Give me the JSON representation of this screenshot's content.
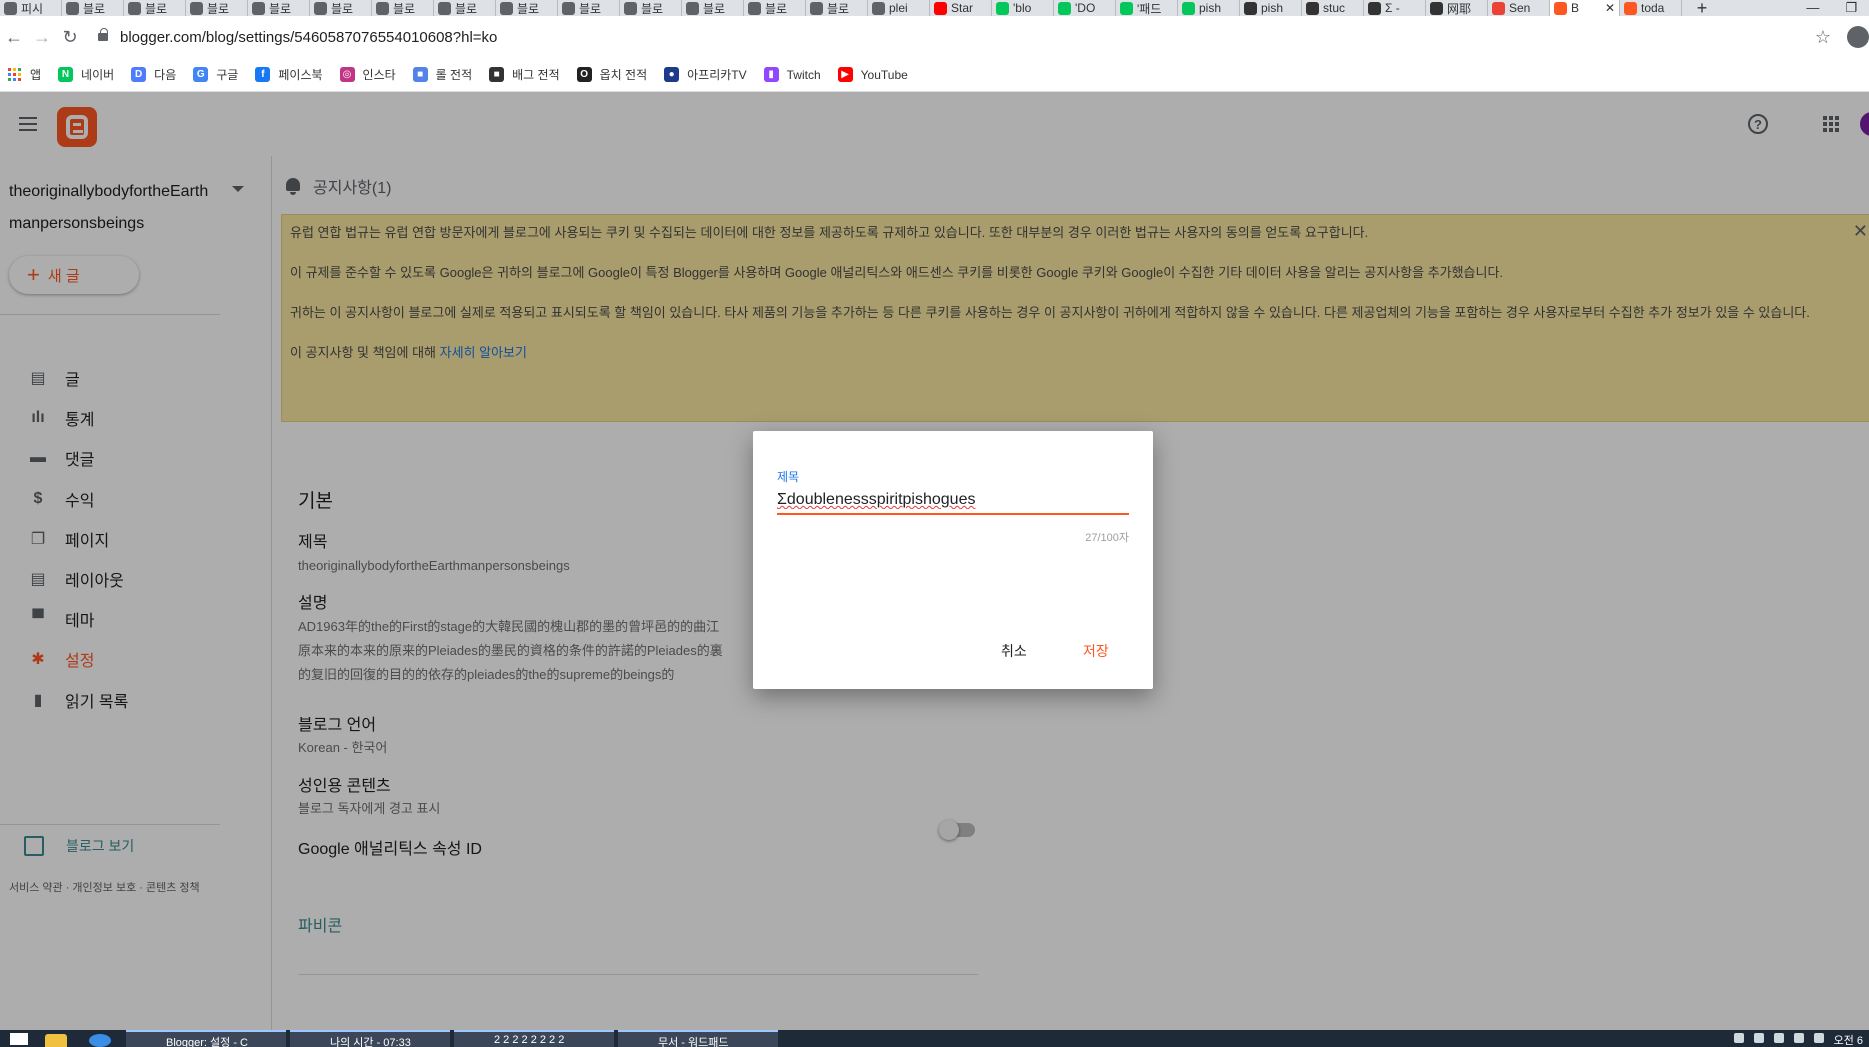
{
  "browser": {
    "tabs": [
      {
        "label": "피시",
        "icon_color": "#5f6368"
      },
      {
        "label": "블로",
        "icon_color": "#5f6368"
      },
      {
        "label": "블로",
        "icon_color": "#5f6368"
      },
      {
        "label": "블로",
        "icon_color": "#5f6368"
      },
      {
        "label": "블로",
        "icon_color": "#5f6368"
      },
      {
        "label": "블로",
        "icon_color": "#5f6368"
      },
      {
        "label": "블로",
        "icon_color": "#5f6368"
      },
      {
        "label": "블로",
        "icon_color": "#5f6368"
      },
      {
        "label": "블로",
        "icon_color": "#5f6368"
      },
      {
        "label": "블로",
        "icon_color": "#5f6368"
      },
      {
        "label": "블로",
        "icon_color": "#5f6368"
      },
      {
        "label": "블로",
        "icon_color": "#5f6368"
      },
      {
        "label": "블로",
        "icon_color": "#5f6368"
      },
      {
        "label": "블로",
        "icon_color": "#5f6368"
      },
      {
        "label": "plei",
        "icon_color": "#5f6368"
      },
      {
        "label": "Star",
        "icon_color": "#ff0000"
      },
      {
        "label": "'blo",
        "icon_color": "#03c75a"
      },
      {
        "label": "'DO",
        "icon_color": "#03c75a"
      },
      {
        "label": "'패드",
        "icon_color": "#03c75a"
      },
      {
        "label": "pish",
        "icon_color": "#03c75a"
      },
      {
        "label": "pish",
        "icon_color": "#333333"
      },
      {
        "label": "stuc",
        "icon_color": "#333333"
      },
      {
        "label": "Σ -",
        "icon_color": "#333333"
      },
      {
        "label": "网耶",
        "icon_color": "#333333"
      },
      {
        "label": "Sen",
        "icon_color": "#ea4335"
      }
    ],
    "active_tab": {
      "label": "B",
      "icon_color": "#ff5722"
    },
    "last_tab": {
      "label": "toda",
      "icon_color": "#ff5722"
    },
    "new_tab": "+",
    "window_controls": [
      "—",
      "❐"
    ],
    "url": "blogger.com/blog/settings/5460587076554010608?hl=ko",
    "bookmarks": [
      {
        "label": "앱",
        "icon": "apps-grid-icon"
      },
      {
        "label": "네이버",
        "icon": "naver-icon",
        "color": "#03c75a",
        "glyph": "N"
      },
      {
        "label": "다음",
        "icon": "daum-icon",
        "color": "#4d7cfe",
        "glyph": "D"
      },
      {
        "label": "구글",
        "icon": "google-icon",
        "color": "#4285f4",
        "glyph": "G"
      },
      {
        "label": "페이스북",
        "icon": "facebook-icon",
        "color": "#1877f2",
        "glyph": "f"
      },
      {
        "label": "인스타",
        "icon": "instagram-icon",
        "color": "#c13584",
        "glyph": "◎"
      },
      {
        "label": "롤 전적",
        "icon": "opgg-icon",
        "color": "#5383e8",
        "glyph": "■"
      },
      {
        "label": "배그 전적",
        "icon": "pubg-icon",
        "color": "#333333",
        "glyph": "■"
      },
      {
        "label": "옵치 전적",
        "icon": "overwatch-icon",
        "color": "#222222",
        "glyph": "O"
      },
      {
        "label": "아프리카TV",
        "icon": "afreecatv-icon",
        "color": "#1e3a8a",
        "glyph": "●"
      },
      {
        "label": "Twitch",
        "icon": "twitch-icon",
        "color": "#9146ff",
        "glyph": "▮"
      },
      {
        "label": "YouTube",
        "icon": "youtube-icon",
        "color": "#ff0000",
        "glyph": "▶"
      }
    ]
  },
  "blogger": {
    "blog_name": "theoriginallybodyfortheEarth manpersonsbeings",
    "new_post_label": "새 글",
    "nav": [
      {
        "label": "글",
        "icon": "posts-icon",
        "glyph": "▤",
        "active": false
      },
      {
        "label": "통계",
        "icon": "stats-icon",
        "glyph": "ılı",
        "active": false
      },
      {
        "label": "댓글",
        "icon": "comments-icon",
        "glyph": "▬",
        "active": false
      },
      {
        "label": "수익",
        "icon": "earnings-icon",
        "glyph": "$",
        "active": false
      },
      {
        "label": "페이지",
        "icon": "pages-icon",
        "glyph": "❐",
        "active": false
      },
      {
        "label": "레이아웃",
        "icon": "layout-icon",
        "glyph": "▤",
        "active": false
      },
      {
        "label": "테마",
        "icon": "theme-icon",
        "glyph": "▀",
        "active": false
      },
      {
        "label": "설정",
        "icon": "settings-icon",
        "glyph": "✱",
        "active": true
      },
      {
        "label": "읽기 목록",
        "icon": "reading-list-icon",
        "glyph": "▮",
        "active": false
      }
    ],
    "view_blog_label": "블로그 보기",
    "footer_links": "서비스 약관 · 개인정보 보호 · 콘텐츠 정책",
    "notice": {
      "heading": "공지사항(1)",
      "p1": "유럽 연합 법규는 유럽 연합 방문자에게 블로그에 사용되는 쿠키 및 수집되는 데이터에 대한 정보를 제공하도록 규제하고 있습니다. 또한 대부분의 경우 이러한 법규는 사용자의 동의를 얻도록 요구합니다.",
      "p2": "이 규제를 준수할 수 있도록 Google은 귀하의 블로그에 Google이 특정 Blogger를 사용하며 Google 애널리틱스와 애드센스 쿠키를 비롯한 Google 쿠키와 Google이 수집한 기타 데이터 사용을 알리는 공지사항을 추가했습니다.",
      "p3": "귀하는 이 공지사항이 블로그에 실제로 적용되고 표시되도록 할 책임이 있습니다. 타사 제품의 기능을 추가하는 등 다른 쿠키를 사용하는 경우 이 공지사항이 귀하에게 적합하지 않을 수 있습니다. 다른 제공업체의 기능을 포함하는 경우 사용자로부터 수집한 추가 정보가 있을 수 있습니다.",
      "p4_prefix": "이 공지사항 및 책임에 대해 ",
      "p4_link": "자세히 알아보기"
    },
    "settings": {
      "section": "기본",
      "title_label": "제목",
      "title_value": "theoriginallybodyfortheEarthmanpersonsbeings",
      "desc_label": "설명",
      "desc_line1": "AD1963年的the的First的stage的大韓民國的槐山郡的墨的曾坪邑的的曲江",
      "desc_line2": "原本来的本来的原来的Pleiades的墨民的資格的条件的許諾的Pleiades的裏",
      "desc_line3": "的复旧的回復的目的的依存的pleiades的the的supreme的beings的",
      "lang_label": "블로그 언어",
      "lang_value": "Korean - 한국어",
      "adult_label": "성인용 콘텐츠",
      "adult_value": "블로그 독자에게 경고 표시",
      "adult_enabled": false,
      "ga_label": "Google 애널리틱스 속성 ID",
      "favicon_label": "파비콘"
    },
    "dialog": {
      "label": "제목",
      "value": "Σdoublenessspiritpishogues",
      "counter": "27/100자",
      "cancel": "취소",
      "save": "저장"
    }
  },
  "taskbar": {
    "apps": [
      {
        "label": "Blogger: 설정 - C"
      },
      {
        "label": "나의 시간 - 07:33"
      },
      {
        "label": "2 2 2 2 2 2 2 2"
      },
      {
        "label": "무서 - 워드패드"
      }
    ],
    "clock": "오전 6"
  }
}
